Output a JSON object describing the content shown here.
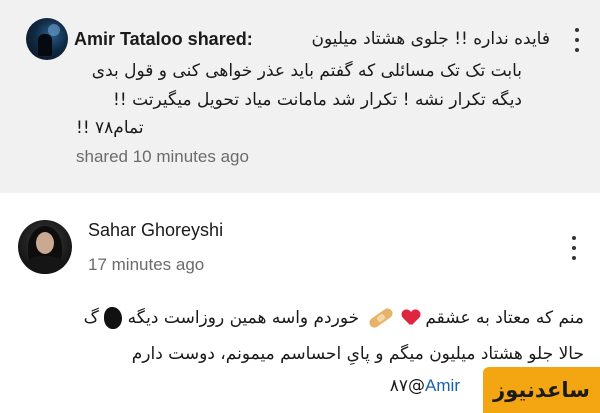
{
  "comments": [
    {
      "author": "Amir Tataloo shared:",
      "text_lines": [
        "فایده نداره !! جلوی هشتاد میلیون",
        "بابت تک تک مسائلی که گفتم باید عذر خواهی کنی و قول بدی",
        "دیگه تکرار نشه ! تکرار شد مامانت میاد تحویل میگیرتت !!",
        "!! ۷۸تمام"
      ],
      "time": "shared 10 minutes ago",
      "highlighted": true
    },
    {
      "author": "Sahar Ghoreyshi",
      "time": "17 minutes ago",
      "text_lines": [
        "خوردم واسه همین روزاست دیگه",
        "منم که معتاد به عشقم",
        "حالا جلو  هشتاد  میلیون میگم و پایِ احساسم میمونم، دوست دارم",
        "۸۷@",
        "Amir"
      ],
      "leading_char": "گ"
    }
  ],
  "watermark": "ساعدنیوز",
  "colors": {
    "highlight_bg": "#f1f1f1",
    "mention": "#1a5fb4",
    "watermark_bg": "#f4a512",
    "heart": "#e0253f"
  }
}
